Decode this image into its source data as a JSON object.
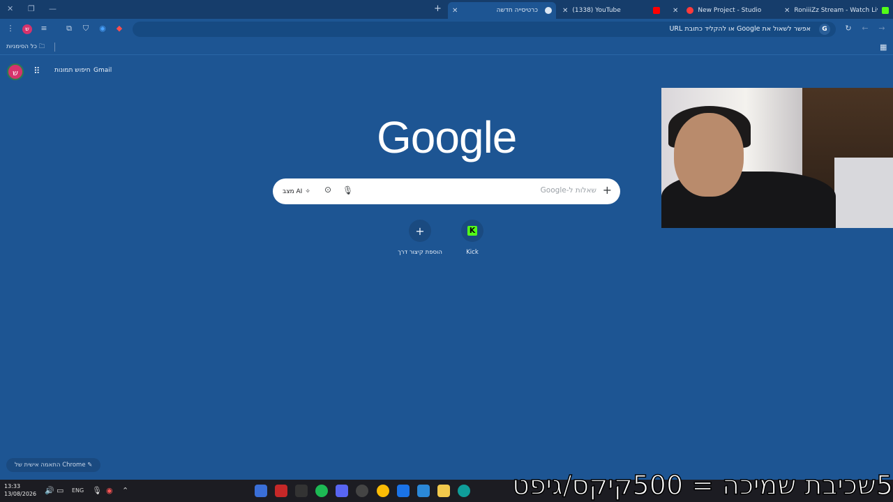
{
  "tabs": [
    {
      "label": "RoniiiZz Stream - Watch Live on",
      "favicon_color": "#53fc18"
    },
    {
      "label": "New Project - Studio",
      "favicon_color": "#ff3b3b"
    },
    {
      "label": "(1338) YouTube",
      "favicon_color": "#ff0000"
    },
    {
      "label": "כרטיסייה חדשה",
      "favicon_color": "#dbe6f3"
    }
  ],
  "omnibox": {
    "placeholder": "אפשר לשאול את Google או להקליד כתובת URL",
    "badge": "G"
  },
  "bookmarks": {
    "all_label": "כל הסימניות"
  },
  "header": {
    "avatar_letter": "ש",
    "images_link": "חיפוש תמונות",
    "gmail_link": "Gmail"
  },
  "google": {
    "logo": "Google"
  },
  "search": {
    "placeholder": "שאלות ל-Google",
    "ai_mode": "מצב AI"
  },
  "shortcuts": [
    {
      "label": "הוספת קיצור דרך",
      "icon": "plus-icon"
    },
    {
      "label": "Kick",
      "icon": "kick-icon",
      "glyph": "K"
    }
  ],
  "customize": {
    "label": "התאמה אישית של Chrome"
  },
  "taskbar": {
    "time": "13:33",
    "date": "13/08/2026",
    "lang": "ENG"
  },
  "overlay_text": "5שכיבת שמיכה = 500קיקס/גיפט",
  "colors": {
    "background": "#1d5593",
    "tabstrip": "#163d6b",
    "kick": "#53fc18",
    "avatar": "#d6336c"
  }
}
